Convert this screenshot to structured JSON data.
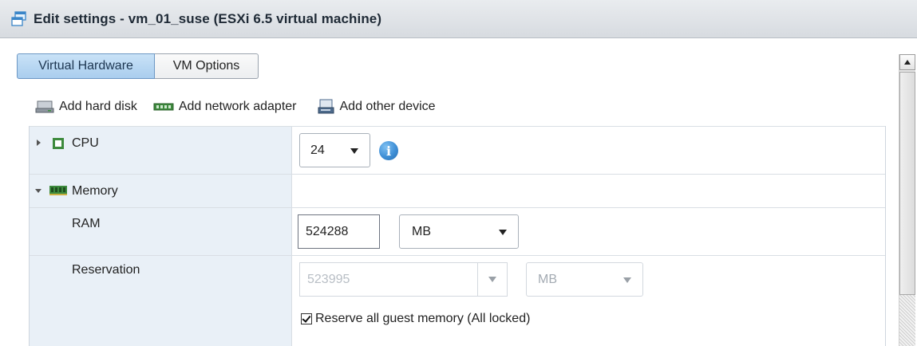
{
  "window": {
    "title": "Edit settings - vm_01_suse (ESXi 6.5 virtual machine)"
  },
  "tabs": [
    {
      "label": "Virtual Hardware",
      "active": true
    },
    {
      "label": "VM Options",
      "active": false
    }
  ],
  "toolbar": {
    "add_hard_disk": "Add hard disk",
    "add_network_adapter": "Add network adapter",
    "add_other_device": "Add other device"
  },
  "hardware": {
    "cpu": {
      "label": "CPU",
      "value": "24"
    },
    "memory": {
      "label": "Memory",
      "ram": {
        "label": "RAM",
        "value": "524288",
        "unit": "MB"
      },
      "reservation": {
        "label": "Reservation",
        "value": "523995",
        "unit": "MB",
        "reserve_all_label": "Reserve all guest memory (All locked)",
        "reserve_all_checked": true
      }
    }
  },
  "colors": {
    "accent": "#3f8fd6",
    "active_tab": "#a9cdee",
    "label_column": "#e9f0f7"
  }
}
